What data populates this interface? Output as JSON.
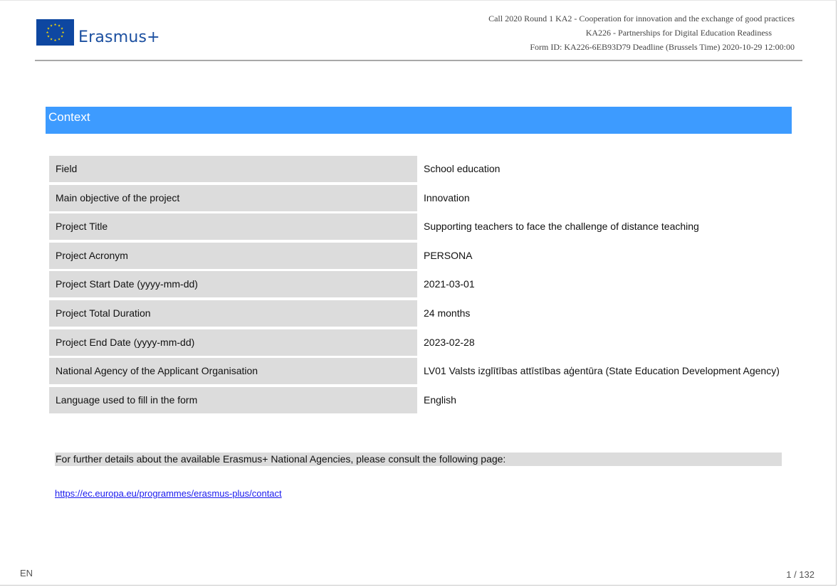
{
  "header": {
    "logo_text": "Erasmus+",
    "line1": "Call 2020 Round 1 KA2 - Cooperation for innovation and the exchange of good practices",
    "line2": "KA226 - Partnerships for Digital Education Readiness",
    "line3": "Form ID: KA226-6EB93D79 Deadline (Brussels Time) 2020-10-29 12:00:00"
  },
  "section": {
    "title": "Context"
  },
  "context_rows": [
    {
      "label": "Field",
      "value": "School education"
    },
    {
      "label": "Main objective of the project",
      "value": "Innovation"
    },
    {
      "label": "Project Title",
      "value": "Supporting teachers to face the challenge of distance teaching"
    },
    {
      "label": "Project Acronym",
      "value": "PERSONA"
    },
    {
      "label": "Project Start Date (yyyy-mm-dd)",
      "value": "2021-03-01"
    },
    {
      "label": "Project Total Duration",
      "value": "24 months"
    },
    {
      "label": "Project End Date (yyyy-mm-dd)",
      "value": "2023-02-28"
    },
    {
      "label": "National Agency of the Applicant Organisation",
      "value": "LV01 Valsts izglītības attīstības aģentūra (State Education Development Agency)"
    },
    {
      "label": "Language used to fill in the form",
      "value": "English"
    }
  ],
  "note": {
    "text": "For further details about the available Erasmus+ National Agencies, please consult the following page:",
    "link": "https://ec.europa.eu/programmes/erasmus-plus/contact"
  },
  "footer": {
    "language": "EN",
    "page": "1 / 132"
  },
  "colors": {
    "section_bar": "#3d9bff",
    "label_bg": "#dcdcdc",
    "link": "#1a1aee",
    "brand_blue": "#1b4fa0",
    "eu_flag_blue": "#0e47a1",
    "eu_star_yellow": "#ffdd00"
  },
  "icons": {
    "logo": "eu-flag-icon"
  }
}
